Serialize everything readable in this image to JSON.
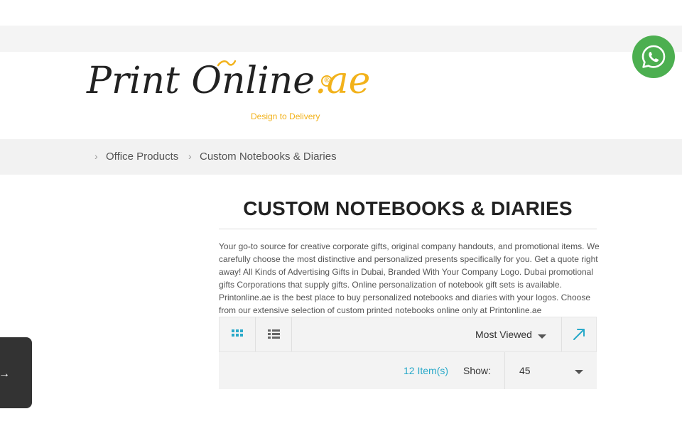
{
  "logo": {
    "name_main": "Print Online",
    "name_ext": ".ae",
    "registered": "®",
    "tagline": "Design to Delivery"
  },
  "breadcrumb": {
    "items": [
      "Office Products",
      "Custom Notebooks & Diaries"
    ]
  },
  "page": {
    "title": "CUSTOM NOTEBOOKS & DIARIES",
    "description": "Your go-to source for creative corporate gifts, original company handouts, and promotional items. We carefully choose the most distinctive and personalized presents specifically for you. Get a quote right away! All Kinds of Advertising Gifts in Dubai, Branded With Your Company Logo. Dubai promotional gifts Corporations that supply gifts. Online personalization of notebook gift sets is available. Printonline.ae is the best place to buy personalized notebooks and diaries with your logos. Choose from our extensive selection of custom printed notebooks online only at Printonline.ae"
  },
  "toolbar": {
    "view_modes": [
      "grid",
      "list"
    ],
    "active_view": "grid",
    "sort_by": "Most Viewed",
    "item_count": "12 Item(s)",
    "show_label": "Show:",
    "limit_value": "45"
  },
  "colors": {
    "accent": "#29a9c9",
    "brand_yellow": "#f2b21b",
    "whatsapp": "#4caf50",
    "side_tab": "#333333"
  },
  "icons": {
    "whatsapp": "whatsapp-icon",
    "grid": "grid-view-icon",
    "list": "list-view-icon",
    "sort_direction": "sort-direction-arrow-icon",
    "breadcrumb_separator": "chevron-right-icon",
    "side_tab": "arrow-right-icon"
  }
}
